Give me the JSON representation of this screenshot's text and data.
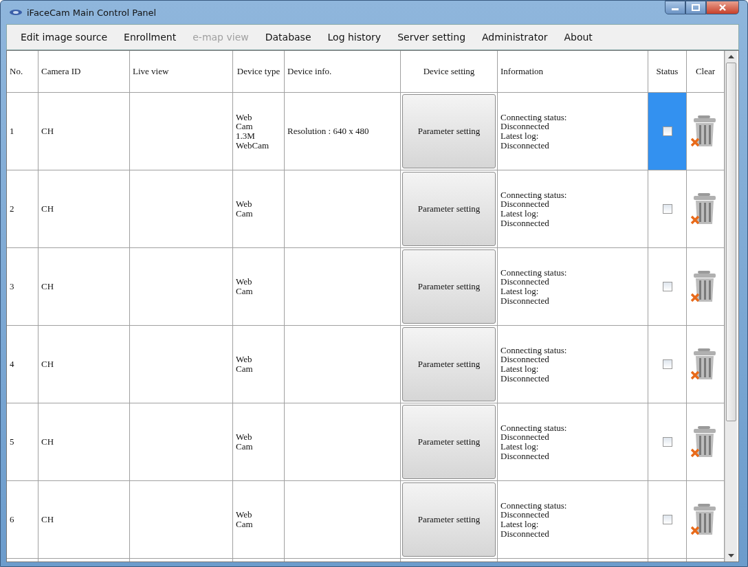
{
  "window": {
    "title": "iFaceCam Main Control Panel"
  },
  "menu": [
    {
      "label": "Edit image source",
      "disabled": false
    },
    {
      "label": "Enrollment",
      "disabled": false
    },
    {
      "label": "e-map view",
      "disabled": true
    },
    {
      "label": "Database",
      "disabled": false
    },
    {
      "label": "Log history",
      "disabled": false
    },
    {
      "label": "Server setting",
      "disabled": false
    },
    {
      "label": "Administrator",
      "disabled": false
    },
    {
      "label": "About",
      "disabled": false
    }
  ],
  "table": {
    "columns": [
      "No.",
      "Camera ID",
      "Live view",
      "Device type",
      "Device info.",
      "Device setting",
      "Information",
      "Status",
      "Clear"
    ],
    "rows": [
      {
        "no": "1",
        "camera_id": "CH",
        "device_type": [
          "Web",
          "Cam",
          "1.3M",
          "WebCam"
        ],
        "device_info": "Resolution : 640 x 480",
        "button": "Parameter setting",
        "information": [
          "Connecting status:",
          "Disconnected",
          "Latest log:",
          "Disconnected"
        ],
        "checked": false,
        "selected": true
      },
      {
        "no": "2",
        "camera_id": "CH",
        "device_type": [
          "Web",
          "Cam"
        ],
        "device_info": "",
        "button": "Parameter setting",
        "information": [
          "Connecting status:",
          "Disconnected",
          "Latest log:",
          "Disconnected"
        ],
        "checked": false,
        "selected": false
      },
      {
        "no": "3",
        "camera_id": "CH",
        "device_type": [
          "Web",
          "Cam"
        ],
        "device_info": "",
        "button": "Parameter setting",
        "information": [
          "Connecting status:",
          "Disconnected",
          "Latest log:",
          "Disconnected"
        ],
        "checked": false,
        "selected": false
      },
      {
        "no": "4",
        "camera_id": "CH",
        "device_type": [
          "Web",
          "Cam"
        ],
        "device_info": "",
        "button": "Parameter setting",
        "information": [
          "Connecting status:",
          "Disconnected",
          "Latest log:",
          "Disconnected"
        ],
        "checked": false,
        "selected": false
      },
      {
        "no": "5",
        "camera_id": "CH",
        "device_type": [
          "Web",
          "Cam"
        ],
        "device_info": "",
        "button": "Parameter setting",
        "information": [
          "Connecting status:",
          "Disconnected",
          "Latest log:",
          "Disconnected"
        ],
        "checked": false,
        "selected": false
      },
      {
        "no": "6",
        "camera_id": "CH",
        "device_type": [
          "Web",
          "Cam"
        ],
        "device_info": "",
        "button": "Parameter setting",
        "information": [
          "Connecting status:",
          "Disconnected",
          "Latest log:",
          "Disconnected"
        ],
        "checked": false,
        "selected": false
      }
    ]
  }
}
